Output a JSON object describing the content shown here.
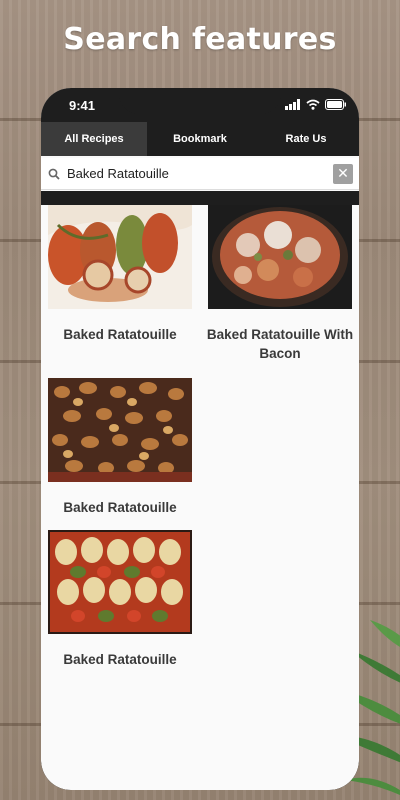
{
  "headline": "Search features",
  "status_bar": {
    "time": "9:41"
  },
  "tabs": [
    {
      "label": "All Recipes",
      "active": true
    },
    {
      "label": "Bookmark",
      "active": false
    },
    {
      "label": "Rate Us",
      "active": false
    }
  ],
  "search": {
    "value": "Baked Ratatouille",
    "clear_icon": "close-icon"
  },
  "results": [
    {
      "title": "Baked Ratatouille",
      "image": "ratatouille-rolls"
    },
    {
      "title": "Baked Ratatouille With Bacon",
      "image": "ratatouille-bacon-skillet"
    },
    {
      "title": "Baked Ratatouille",
      "image": "ratatouille-tray"
    },
    {
      "title": "Baked Ratatouille",
      "image": "ratatouille-sliced-casserole"
    }
  ],
  "colors": {
    "bar_dark": "#1e1e1e",
    "tab_active": "#3b3b3b",
    "screen_bg": "#fafafa",
    "wood": "#a18f7e"
  }
}
